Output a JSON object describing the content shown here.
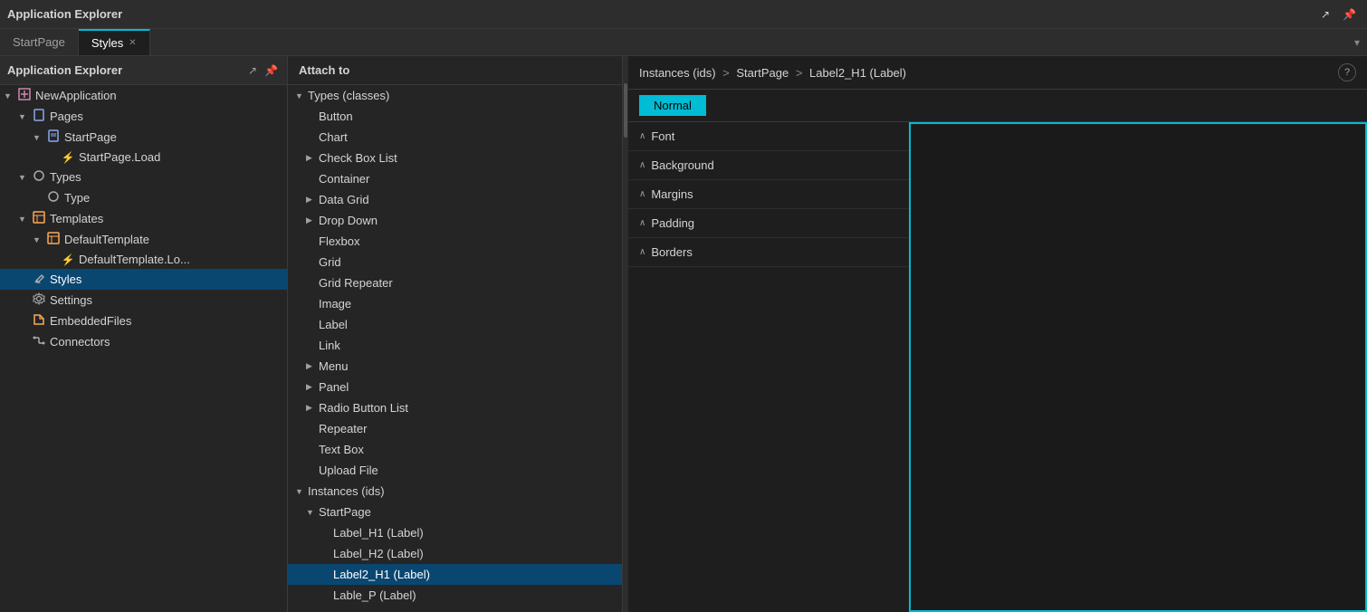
{
  "appTitle": "Application Explorer",
  "titleBarActions": [
    "↗",
    "📌"
  ],
  "tabs": [
    {
      "id": "startpage",
      "label": "StartPage",
      "active": false,
      "closable": false
    },
    {
      "id": "styles",
      "label": "Styles",
      "active": true,
      "closable": true
    }
  ],
  "tabBarArrow": "▾",
  "sidebar": {
    "items": [
      {
        "id": "new-application",
        "label": "NewApplication",
        "indent": 0,
        "icon": "app-icon",
        "arrow": "▼",
        "selected": false
      },
      {
        "id": "pages",
        "label": "Pages",
        "indent": 1,
        "icon": "pages-icon",
        "arrow": "▼",
        "selected": false
      },
      {
        "id": "startpage-node",
        "label": "StartPage",
        "indent": 2,
        "icon": "page-icon",
        "arrow": "▼",
        "selected": false
      },
      {
        "id": "startpage-load",
        "label": "StartPage.Load",
        "indent": 3,
        "icon": "bolt-icon",
        "arrow": "",
        "selected": false
      },
      {
        "id": "types",
        "label": "Types",
        "indent": 1,
        "icon": "types-icon",
        "arrow": "▼",
        "selected": false
      },
      {
        "id": "type",
        "label": "Type",
        "indent": 2,
        "icon": "type-icon",
        "arrow": "",
        "selected": false
      },
      {
        "id": "templates",
        "label": "Templates",
        "indent": 1,
        "icon": "templates-icon",
        "arrow": "▼",
        "selected": false
      },
      {
        "id": "defaulttemplate",
        "label": "DefaultTemplate",
        "indent": 2,
        "icon": "template-icon",
        "arrow": "▼",
        "selected": false
      },
      {
        "id": "defaulttemplate-load",
        "label": "DefaultTemplate.Lo...",
        "indent": 3,
        "icon": "bolt-icon",
        "arrow": "",
        "selected": false
      },
      {
        "id": "styles-node",
        "label": "Styles",
        "indent": 1,
        "icon": "styles-icon",
        "arrow": "",
        "selected": true
      },
      {
        "id": "settings",
        "label": "Settings",
        "indent": 1,
        "icon": "settings-icon",
        "arrow": "",
        "selected": false
      },
      {
        "id": "embedded-files",
        "label": "EmbeddedFiles",
        "indent": 1,
        "icon": "folder-icon",
        "arrow": "",
        "selected": false
      },
      {
        "id": "connectors",
        "label": "Connectors",
        "indent": 1,
        "icon": "connectors-icon",
        "arrow": "",
        "selected": false
      }
    ]
  },
  "middlePanel": {
    "header": "Attach to",
    "items": [
      {
        "id": "types-classes",
        "label": "Types (classes)",
        "indent": 0,
        "arrow": "▼",
        "selected": false
      },
      {
        "id": "button",
        "label": "Button",
        "indent": 1,
        "arrow": "",
        "selected": false
      },
      {
        "id": "chart",
        "label": "Chart",
        "indent": 1,
        "arrow": "",
        "selected": false
      },
      {
        "id": "check-box-list",
        "label": "Check Box List",
        "indent": 1,
        "arrow": "▶",
        "selected": false
      },
      {
        "id": "container",
        "label": "Container",
        "indent": 1,
        "arrow": "",
        "selected": false
      },
      {
        "id": "data-grid",
        "label": "Data Grid",
        "indent": 1,
        "arrow": "▶",
        "selected": false
      },
      {
        "id": "drop-down",
        "label": "Drop Down",
        "indent": 1,
        "arrow": "▶",
        "selected": false
      },
      {
        "id": "flexbox",
        "label": "Flexbox",
        "indent": 1,
        "arrow": "",
        "selected": false
      },
      {
        "id": "grid",
        "label": "Grid",
        "indent": 1,
        "arrow": "",
        "selected": false
      },
      {
        "id": "grid-repeater",
        "label": "Grid Repeater",
        "indent": 1,
        "arrow": "",
        "selected": false
      },
      {
        "id": "image",
        "label": "Image",
        "indent": 1,
        "arrow": "",
        "selected": false
      },
      {
        "id": "label",
        "label": "Label",
        "indent": 1,
        "arrow": "",
        "selected": false
      },
      {
        "id": "link",
        "label": "Link",
        "indent": 1,
        "arrow": "",
        "selected": false
      },
      {
        "id": "menu",
        "label": "Menu",
        "indent": 1,
        "arrow": "▶",
        "selected": false
      },
      {
        "id": "panel",
        "label": "Panel",
        "indent": 1,
        "arrow": "▶",
        "selected": false
      },
      {
        "id": "radio-button-list",
        "label": "Radio Button List",
        "indent": 1,
        "arrow": "▶",
        "selected": false
      },
      {
        "id": "repeater",
        "label": "Repeater",
        "indent": 1,
        "arrow": "",
        "selected": false
      },
      {
        "id": "text-box",
        "label": "Text Box",
        "indent": 1,
        "arrow": "",
        "selected": false
      },
      {
        "id": "upload-file",
        "label": "Upload File",
        "indent": 1,
        "arrow": "",
        "selected": false
      },
      {
        "id": "instances-ids",
        "label": "Instances (ids)",
        "indent": 0,
        "arrow": "▼",
        "selected": false
      },
      {
        "id": "startpage-inst",
        "label": "StartPage",
        "indent": 1,
        "arrow": "▼",
        "selected": false
      },
      {
        "id": "label-h1",
        "label": "Label_H1 (Label)",
        "indent": 2,
        "arrow": "",
        "selected": false
      },
      {
        "id": "label-h2",
        "label": "Label_H2 (Label)",
        "indent": 2,
        "arrow": "",
        "selected": false
      },
      {
        "id": "label2-h1",
        "label": "Label2_H1 (Label)",
        "indent": 2,
        "arrow": "",
        "selected": true
      },
      {
        "id": "lable-p",
        "label": "Lable_P (Label)",
        "indent": 2,
        "arrow": "",
        "selected": false
      }
    ]
  },
  "rightPanel": {
    "breadcrumb": {
      "parts": [
        "Instances (ids)",
        "StartPage",
        "Label2_H1 (Label)"
      ],
      "separator": ">"
    },
    "helpLabel": "?",
    "normalTab": "Normal",
    "propertySections": [
      {
        "id": "font",
        "label": "Font",
        "expanded": true
      },
      {
        "id": "background",
        "label": "Background",
        "expanded": true
      },
      {
        "id": "margins",
        "label": "Margins",
        "expanded": true
      },
      {
        "id": "padding",
        "label": "Padding",
        "expanded": true
      },
      {
        "id": "borders",
        "label": "Borders",
        "expanded": true
      }
    ]
  },
  "colors": {
    "accent": "#00bcd4",
    "bg": "#1e1e1e",
    "sidebar": "#252526",
    "selected": "#094771",
    "border": "#3a3a3a"
  },
  "icons": {
    "app-icon": "⊞",
    "pages-icon": "📄",
    "page-icon": "📄",
    "bolt-icon": "⚡",
    "types-icon": "⊙",
    "type-icon": "⊙",
    "templates-icon": "⊞",
    "template-icon": "⊞",
    "styles-icon": "✏",
    "settings-icon": "⚙",
    "folder-icon": "📁",
    "connectors-icon": "⫟"
  }
}
